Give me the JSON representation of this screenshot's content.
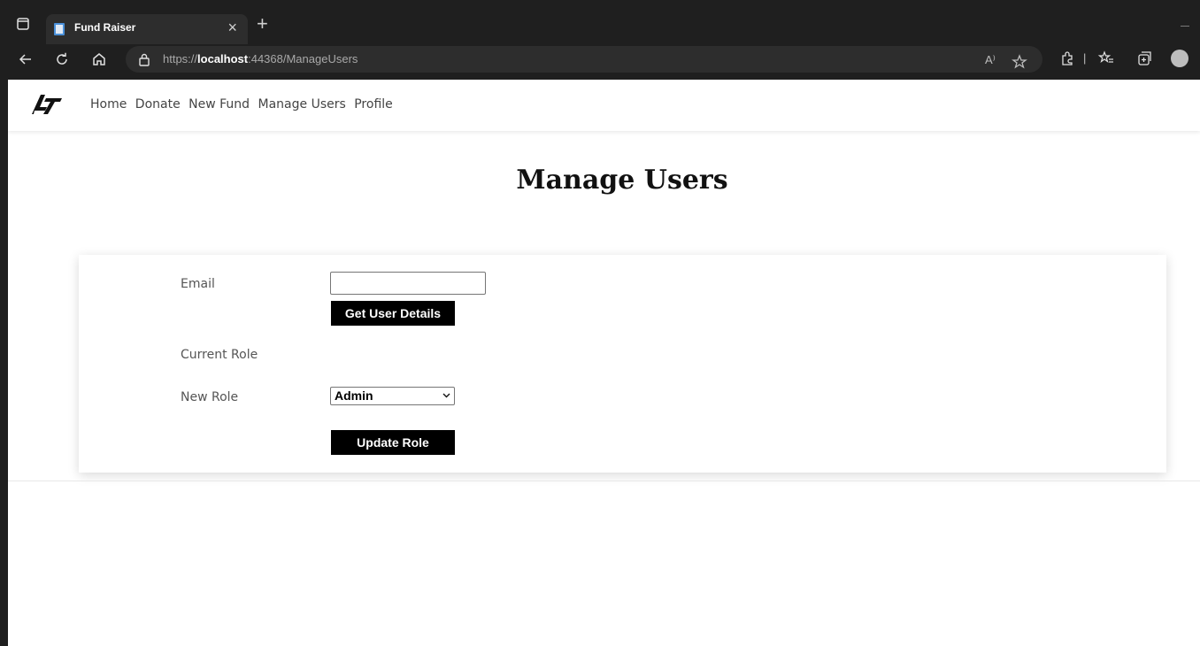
{
  "browser": {
    "tab_title": "Fund Raiser",
    "tab_close": "×",
    "new_tab": "+",
    "url_scheme": "https://",
    "url_host": "localhost",
    "url_rest": ":44368/ManageUsers",
    "read_aloud": "A⁾",
    "divider": "|"
  },
  "navbar": {
    "links": [
      "Home",
      "Donate",
      "New Fund",
      "Manage Users",
      "Profile"
    ]
  },
  "page": {
    "title": "Manage Users"
  },
  "form": {
    "email_label": "Email",
    "email_value": "",
    "get_details_button": "Get User Details",
    "current_role_label": "Current Role",
    "current_role_value": "",
    "new_role_label": "New Role",
    "new_role_selected": "Admin",
    "update_role_button": "Update Role"
  },
  "colors": {
    "browser_chrome": "#1f1f1f",
    "button_bg": "#000000",
    "button_text": "#ffffff"
  },
  "icons": [
    "window-icon",
    "page-icon",
    "back-icon",
    "reload-icon",
    "home-icon",
    "lock-icon",
    "favorite-icon",
    "extensions-icon",
    "favorites-list-icon",
    "collections-icon",
    "profile-icon",
    "logo-icon",
    "chevron-down-icon"
  ]
}
